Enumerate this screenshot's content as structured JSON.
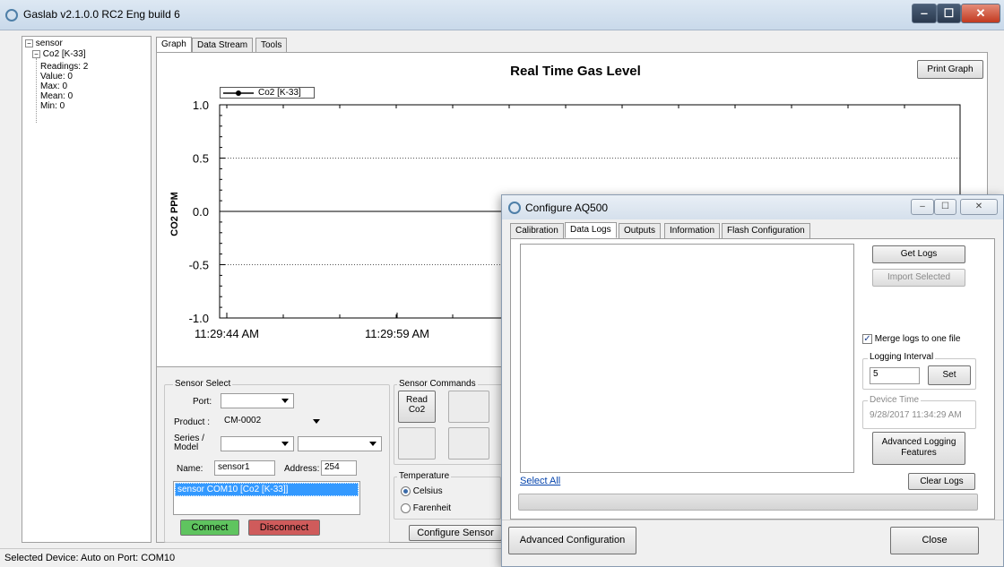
{
  "main_window": {
    "title": "Gaslab v2.1.0.0 RC2 Eng build 6",
    "icon": "gaslab-app-icon",
    "controls": {
      "minimize": "‒",
      "maximize": "☐",
      "close": "✕"
    }
  },
  "tree": {
    "root": "sensor",
    "device": "Co2 [K-33]",
    "children": [
      "Readings: 2",
      "Value: 0",
      "Max: 0",
      "Mean: 0",
      "Min: 0"
    ]
  },
  "main_tabs": [
    "Graph",
    "Data Stream",
    "Tools"
  ],
  "graph": {
    "print_button": "Print Graph",
    "chart_data": {
      "type": "line",
      "title": "Real Time Gas Level",
      "ylabel": "CO2 PPM",
      "xlabel": "",
      "ylim": [
        -1.0,
        1.0
      ],
      "y_ticks": [
        "1.0",
        "0.5",
        "0.0",
        "-0.5",
        "-1.0"
      ],
      "x_ticks": [
        "11:29:44 AM",
        "11:29:59 AM"
      ],
      "grid": "dotted horizontal",
      "legend": "top-left",
      "series": [
        {
          "name": "Co2 [K-33]",
          "x": [],
          "values": []
        }
      ]
    }
  },
  "sensor_select": {
    "legend": "Sensor Select",
    "port_label": "Port:",
    "port_value": "",
    "product_label": "Product :",
    "product_value": "CM-0002",
    "series_label": "Series /\nModel",
    "series_value": "",
    "model_value": "",
    "name_label": "Name:",
    "name_value": "sensor1",
    "address_label": "Address:",
    "address_value": "254",
    "device_list": [
      "sensor COM10 [Co2 [K-33]]"
    ],
    "connect": "Connect",
    "disconnect": "Disconnect",
    "connect_color": "#5fc45f",
    "disconnect_color": "#cf5b5b"
  },
  "sensor_commands": {
    "legend": "Sensor Commands",
    "read_button": "Read\nCo2"
  },
  "temperature": {
    "legend": "Temperature",
    "options": [
      "Celsius",
      "Farenheit"
    ],
    "selected": "Celsius"
  },
  "configure_sensor_button": "Configure Sensor",
  "status_bar": "Selected Device: Auto on Port: COM10",
  "dialog": {
    "title": "Configure AQ500",
    "icon": "gaslab-app-icon",
    "tabs": [
      "Calibration",
      "Data Logs",
      "Outputs",
      "Information",
      "Flash Configuration"
    ],
    "active_tab": "Data Logs",
    "get_logs": "Get Logs",
    "import_selected": "Import Selected",
    "merge_label": "Merge logs to one file",
    "merge_checked": true,
    "logging_interval_legend": "Logging Interval",
    "logging_interval_value": "5",
    "set_button": "Set",
    "device_time_legend": "Device Time",
    "device_time_value": "9/28/2017 11:34:29 AM",
    "advanced_logging": "Advanced Logging\nFeatures",
    "select_all": "Select All",
    "clear_logs": "Clear Logs",
    "advanced_configuration": "Advanced Configuration",
    "close": "Close"
  }
}
